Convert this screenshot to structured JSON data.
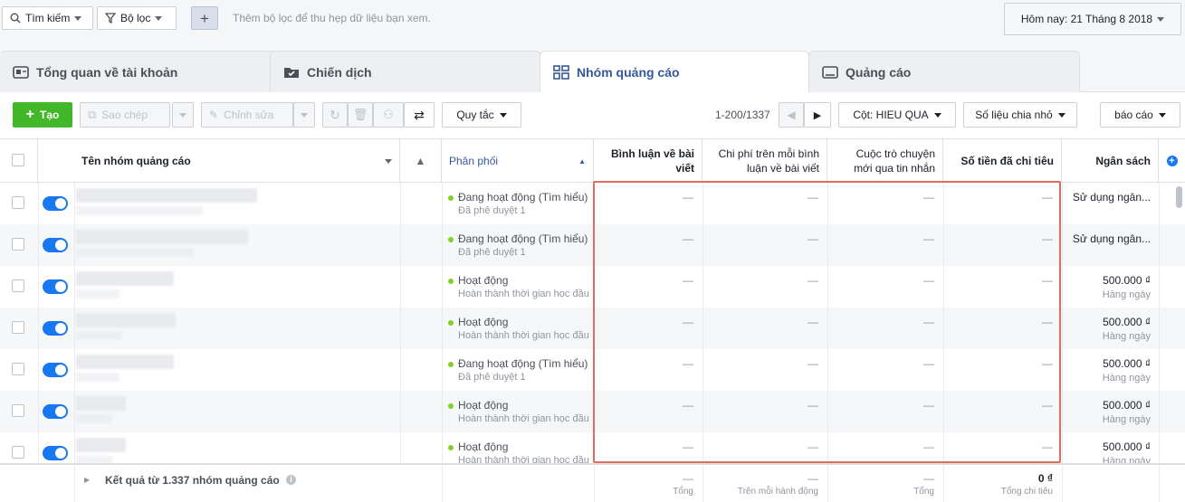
{
  "topbar": {
    "search_label": "Tìm kiếm",
    "filter_label": "Bộ lọc",
    "filter_placeholder": "Thêm bộ lọc để thu hẹp dữ liệu bạn xem.",
    "date_label": "Hôm nay: 21 Tháng 8 2018"
  },
  "tabs": [
    {
      "label": "Tổng quan về tài khoản"
    },
    {
      "label": "Chiến dịch"
    },
    {
      "label": "Nhóm quảng cáo"
    },
    {
      "label": "Quảng cáo"
    }
  ],
  "toolbar": {
    "create": "Tạo",
    "copy": "Sao chép",
    "edit": "Chỉnh sửa",
    "rules": "Quy tắc",
    "pagination": "1-200/1337",
    "columns": "Cột: HIEU QUA",
    "breakdown": "Số liệu chia nhỏ",
    "report": "báo cáo"
  },
  "header": {
    "name": "Tên nhóm quảng cáo",
    "delivery": "Phân phối",
    "comments": "Bình luận về bài viết",
    "cost_per_comment": "Chi phí trên mỗi bình luận về bài viết",
    "conversations": "Cuộc trò chuyện mới qua tin nhắn",
    "spent": "Số tiền đã chi tiêu",
    "budget": "Ngân sách"
  },
  "rows": [
    {
      "status": "Đang hoạt động (Tìm hiểu)",
      "sub": "Đã phê duyệt 1",
      "comments": "—",
      "cpc": "—",
      "conv": "—",
      "spent": "—",
      "budget": "Sử dụng ngân...",
      "budget_sub": ""
    },
    {
      "status": "Đang hoạt động (Tìm hiểu)",
      "sub": "Đã phê duyệt 1",
      "comments": "—",
      "cpc": "—",
      "conv": "—",
      "spent": "—",
      "budget": "Sử dụng ngân...",
      "budget_sub": ""
    },
    {
      "status": "Hoạt động",
      "sub": "Hoàn thành thời gian học đầu",
      "comments": "—",
      "cpc": "—",
      "conv": "—",
      "spent": "—",
      "budget": "500.000 ₫",
      "budget_sub": "Hàng ngày"
    },
    {
      "status": "Hoạt động",
      "sub": "Hoàn thành thời gian học đầu",
      "comments": "—",
      "cpc": "—",
      "conv": "—",
      "spent": "—",
      "budget": "500.000 ₫",
      "budget_sub": "Hàng ngày"
    },
    {
      "status": "Đang hoạt động (Tìm hiểu)",
      "sub": "Đã phê duyệt 1",
      "comments": "—",
      "cpc": "—",
      "conv": "—",
      "spent": "—",
      "budget": "500.000 ₫",
      "budget_sub": "Hàng ngày"
    },
    {
      "status": "Hoạt động",
      "sub": "Hoàn thành thời gian học đầu",
      "comments": "—",
      "cpc": "—",
      "conv": "—",
      "spent": "—",
      "budget": "500.000 ₫",
      "budget_sub": "Hàng ngày"
    },
    {
      "status": "Hoạt động",
      "sub": "Hoàn thành thời gian học đầu",
      "comments": "—",
      "cpc": "—",
      "conv": "—",
      "spent": "—",
      "budget": "500.000 ₫",
      "budget_sub": "Hàng ngày"
    }
  ],
  "footer": {
    "summary": "Kết quả từ 1.337 nhóm quảng cáo",
    "comments": "—",
    "comments_sub": "Tổng",
    "cpc": "—",
    "cpc_sub": "Trên mỗi hành động",
    "conv": "—",
    "conv_sub": "Tổng",
    "spent": "0 ₫",
    "spent_sub": "Tổng chi tiêu"
  },
  "colors": {
    "accent": "#365899",
    "green": "#42b72a",
    "toggle": "#1877f2",
    "highlight": "#e06c5c"
  }
}
